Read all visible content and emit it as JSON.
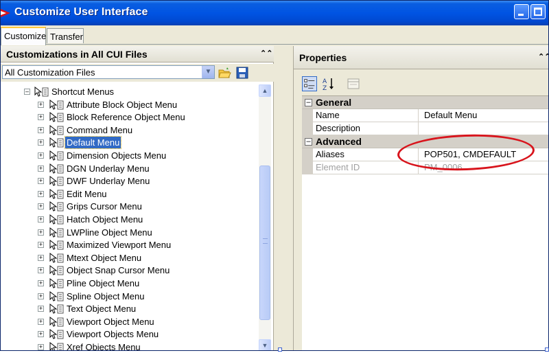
{
  "window": {
    "title": "Customize User Interface"
  },
  "tabs": [
    {
      "label": "Customize",
      "active": true
    },
    {
      "label": "Transfer",
      "active": false
    }
  ],
  "left_panel": {
    "title": "Customizations in All CUI Files",
    "file_filter": {
      "value": "All Customization Files"
    },
    "tree": {
      "root": {
        "label": "Shortcut Menus",
        "expanded": true
      },
      "items": [
        {
          "label": "Attribute Block Object Menu"
        },
        {
          "label": "Block Reference Object Menu"
        },
        {
          "label": "Command Menu"
        },
        {
          "label": "Default Menu",
          "selected": true
        },
        {
          "label": "Dimension Objects Menu"
        },
        {
          "label": "DGN Underlay Menu"
        },
        {
          "label": "DWF Underlay Menu"
        },
        {
          "label": "Edit Menu"
        },
        {
          "label": "Grips Cursor Menu"
        },
        {
          "label": "Hatch Object Menu"
        },
        {
          "label": "LWPline Object Menu"
        },
        {
          "label": "Maximized Viewport Menu"
        },
        {
          "label": "Mtext Object Menu"
        },
        {
          "label": "Object Snap Cursor Menu"
        },
        {
          "label": "Pline Object Menu"
        },
        {
          "label": "Spline Object Menu"
        },
        {
          "label": "Text Object Menu"
        },
        {
          "label": "Viewport Object Menu"
        },
        {
          "label": "Viewport Objects Menu"
        },
        {
          "label": "Xref Objects Menu"
        }
      ]
    }
  },
  "right_panel": {
    "title": "Properties",
    "categories": [
      {
        "name": "General",
        "rows": [
          {
            "name": "Name",
            "value": "Default Menu"
          },
          {
            "name": "Description",
            "value": ""
          }
        ]
      },
      {
        "name": "Advanced",
        "rows": [
          {
            "name": "Aliases",
            "value": "POP501, CMDEFAULT"
          },
          {
            "name": "Element ID",
            "value": "PM_0006",
            "disabled": true
          }
        ]
      }
    ]
  },
  "colors": {
    "title_bar": "#0054e3",
    "selection": "#316ac5",
    "annotation": "#d8141c"
  }
}
